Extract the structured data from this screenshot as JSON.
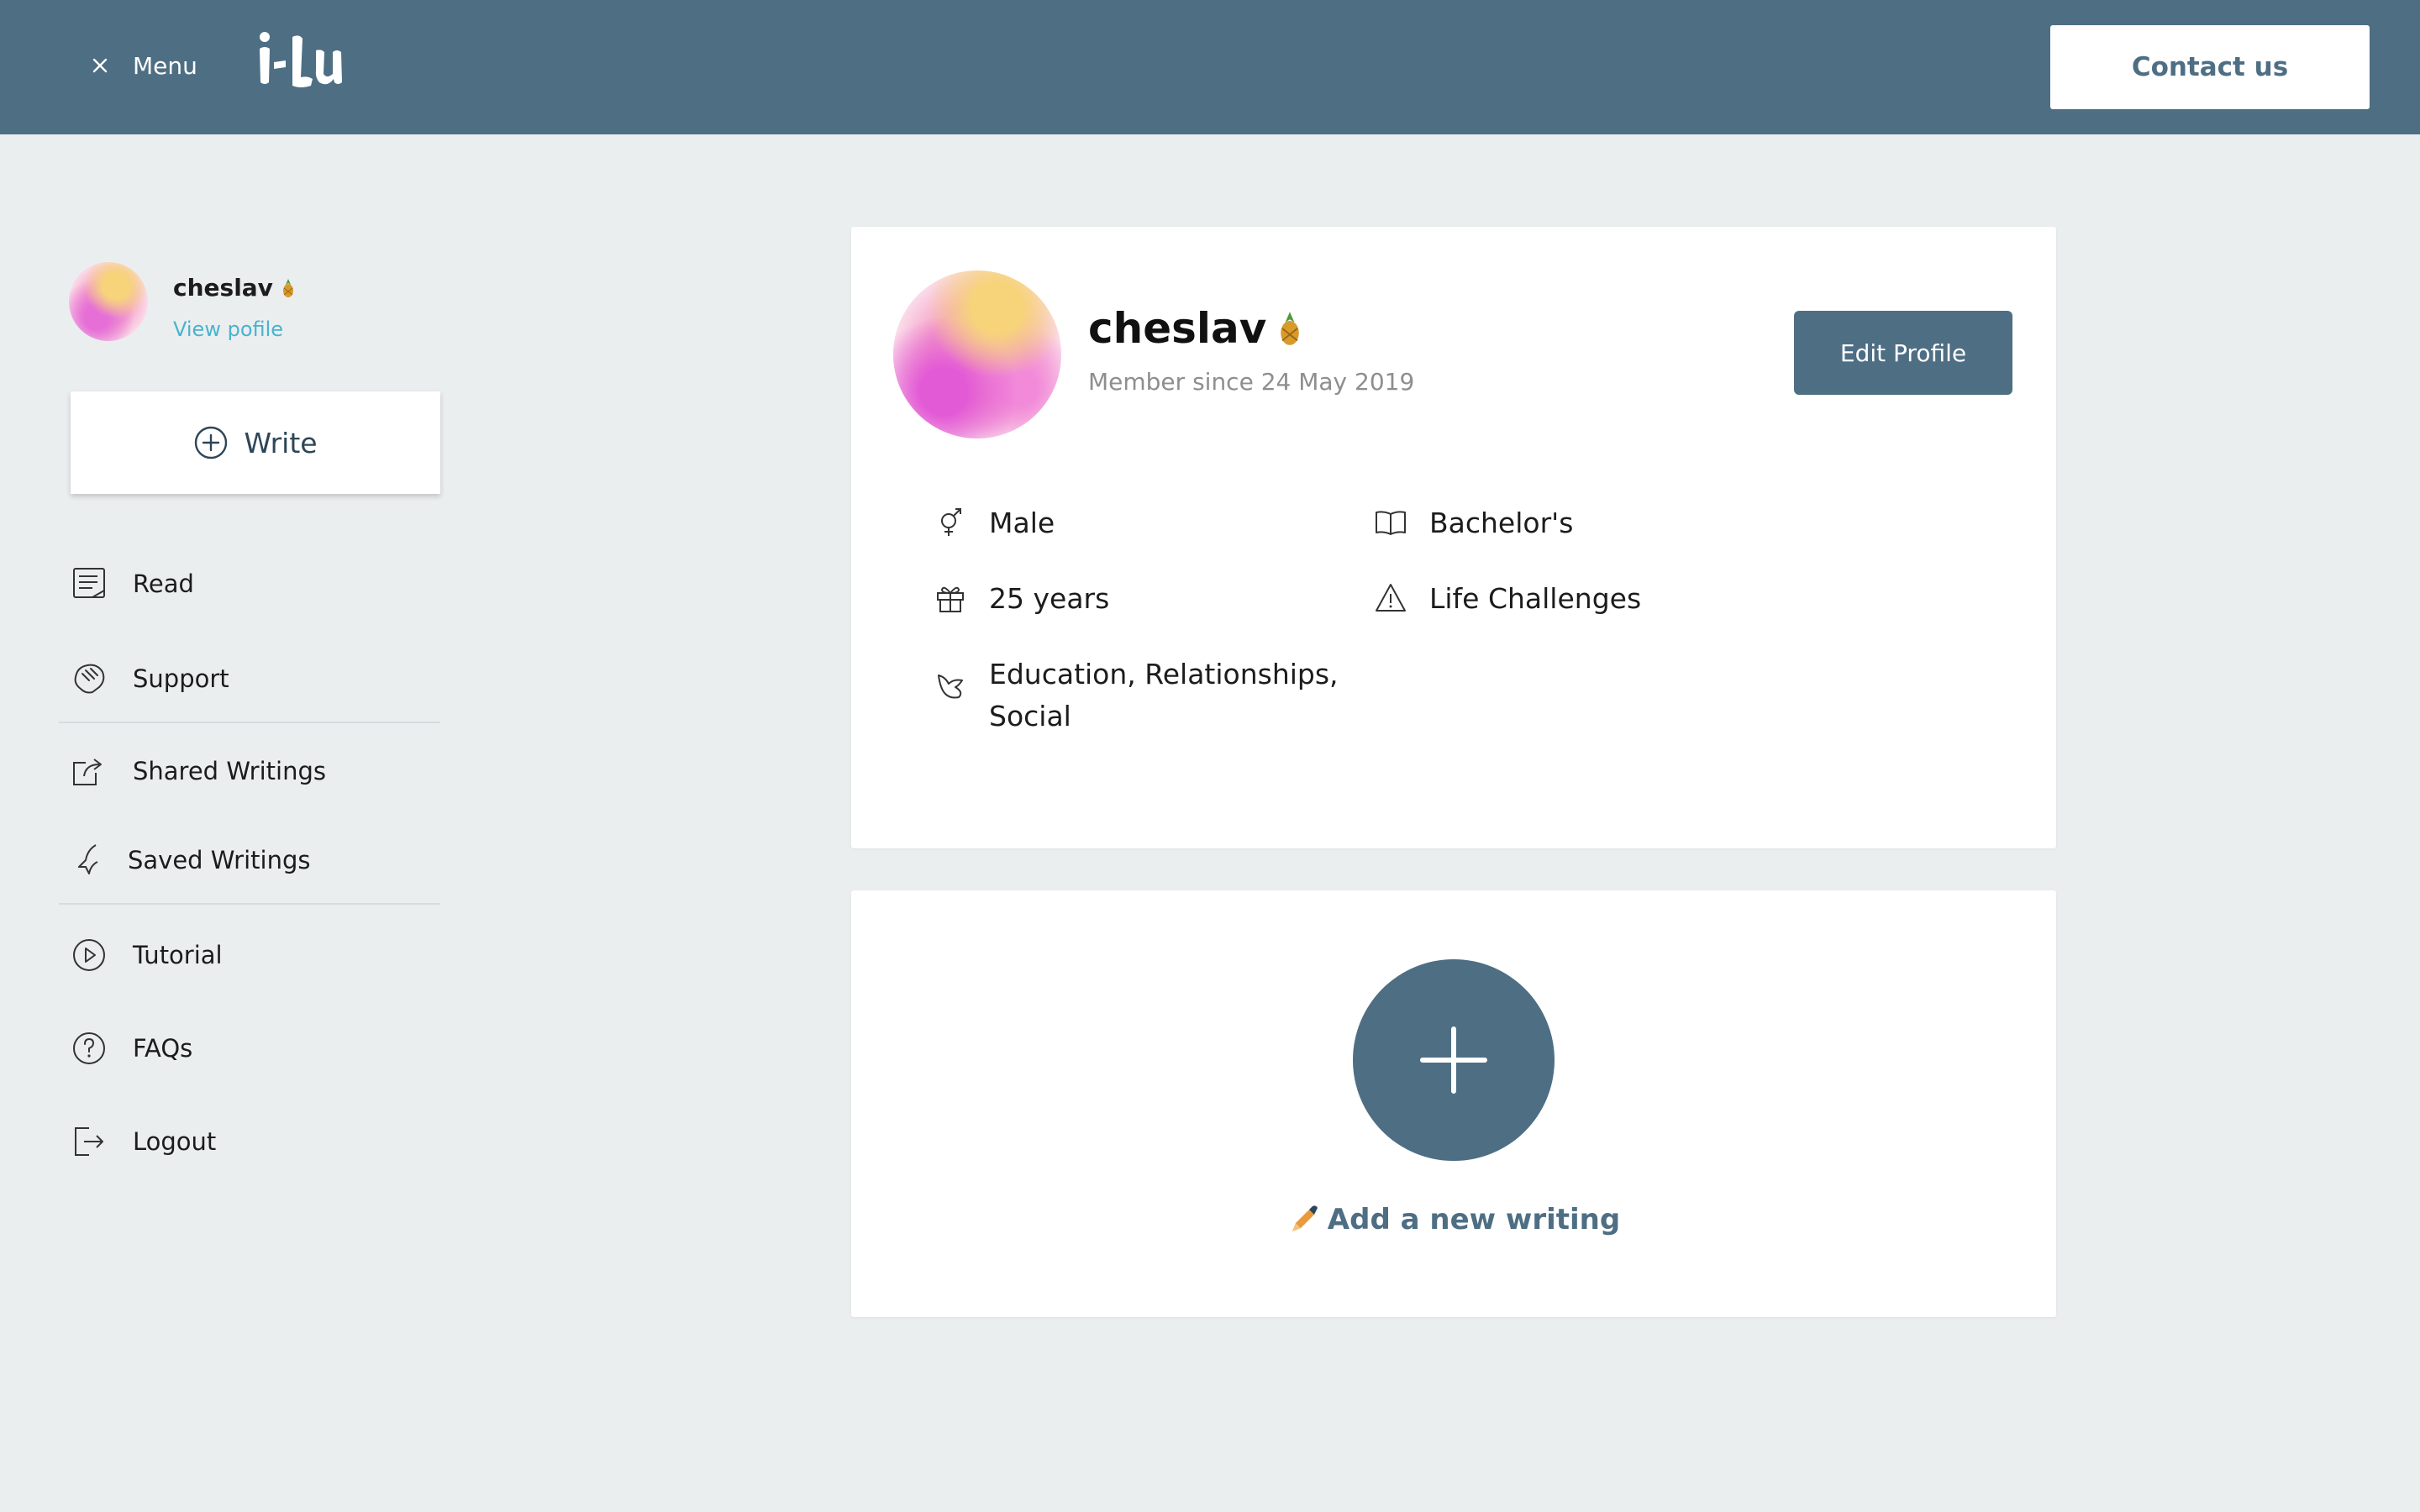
{
  "header": {
    "menu_label": "Menu",
    "close_icon": "close-icon",
    "logo_text": "i-Lu",
    "contact_label": "Contact us",
    "colors": {
      "bar": "#4e6e84",
      "contact_bg": "#ffffff",
      "contact_text": "#4e6e84"
    }
  },
  "sidebar": {
    "profile": {
      "name": "cheslav",
      "badge_icon": "pineapple-icon",
      "link": "View pofile"
    },
    "write_label": "Write",
    "items": [
      {
        "label": "Read",
        "icon": "document-icon"
      },
      {
        "label": "Support",
        "icon": "hands-icon"
      },
      {
        "label": "Shared Writings",
        "icon": "share-icon"
      },
      {
        "label": "Saved Writings",
        "icon": "bird-icon"
      },
      {
        "label": "Tutorial",
        "icon": "play-icon"
      },
      {
        "label": "FAQs",
        "icon": "question-icon"
      },
      {
        "label": "Logout",
        "icon": "logout-icon"
      }
    ]
  },
  "profile": {
    "name": "cheslav",
    "badge_icon": "pineapple-icon",
    "member_since": "Member since 24 May 2019",
    "edit_label": "Edit Profile",
    "attributes": {
      "gender": "Male",
      "education": "Bachelor's",
      "age": "25 years",
      "challenges": "Life Challenges",
      "interests_line1": "Education, Relationships,",
      "interests_line2": "Social"
    }
  },
  "add_writing": {
    "label": "Add a new writing",
    "icon": "pen-icon"
  },
  "colors": {
    "accent": "#4e6e84",
    "link": "#49b3cf",
    "background": "#ebeeef"
  }
}
